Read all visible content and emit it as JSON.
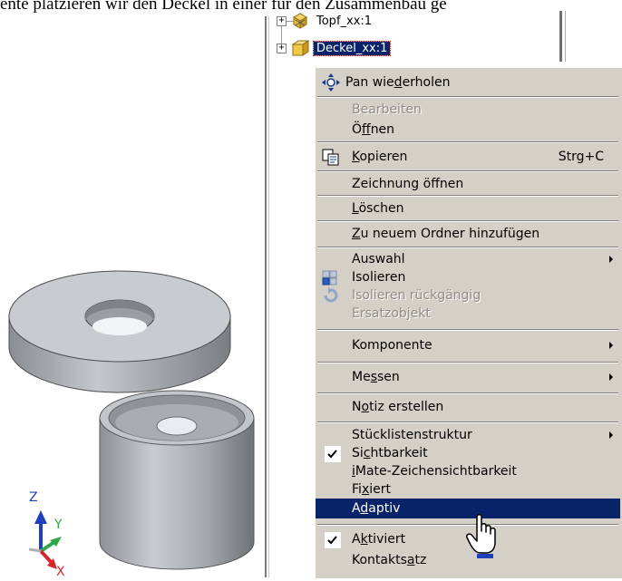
{
  "caption": "ente platzieren wir den Deckel in einer für den Zusammenbau ge",
  "tree": {
    "items": [
      {
        "label": "Topf_xx:1",
        "icon": "assembly-icon",
        "expander": "+"
      },
      {
        "label": "Deckel_xx:1",
        "icon": "part-icon",
        "expander": "+",
        "selected": true
      }
    ]
  },
  "menu": {
    "pan": {
      "pre": "Pan wie",
      "ul": "d",
      "post": "erholen"
    },
    "edit": {
      "label": "Bearbeiten",
      "disabled": true
    },
    "open": {
      "pre": "Ö",
      "ul": "f",
      "post": "fnen"
    },
    "copy": {
      "ul": "K",
      "post": "opieren",
      "shortcut": "Strg+C"
    },
    "open_drawing": {
      "pre": "Zeichnun",
      "ul": "g",
      "post": " öffnen"
    },
    "delete": {
      "ul": "L",
      "post": "öschen"
    },
    "add_folder": {
      "ul": "Z",
      "post": "u neuem Ordner hinzufügen"
    },
    "selection": {
      "label": "Auswahl"
    },
    "isolate": {
      "label": "Isolieren"
    },
    "undo_isolate": {
      "label": "Isolieren rückgängig",
      "disabled": true
    },
    "substitute": {
      "label": "Ersatzobjekt",
      "disabled": true
    },
    "component": {
      "label": "Komponente"
    },
    "measure": {
      "pre": "Me",
      "ul": "s",
      "post": "sen"
    },
    "note": {
      "pre": "N",
      "ul": "o",
      "post": "tiz erstellen"
    },
    "bom": {
      "label": "Stücklistenstruktur"
    },
    "visibility": {
      "pre": "Si",
      "ul": "c",
      "post": "htbarkeit",
      "checked": true
    },
    "imate": {
      "pre": "",
      "ul": "i",
      "post": "Mate-Zeichensichtbarkeit"
    },
    "fixed": {
      "pre": "Fi",
      "ul": "x",
      "post": "iert"
    },
    "adaptive": {
      "pre": "A",
      "ul": "d",
      "post": "aptiv",
      "highlighted": true
    },
    "activated": {
      "pre": "A",
      "ul": "k",
      "post": "tiviert",
      "checked": true
    },
    "contact_set": {
      "pre": "Kontakts",
      "ul": "a",
      "post": "tz"
    }
  },
  "axes": {
    "z": "Z",
    "y": "Y",
    "x": "X"
  },
  "colors": {
    "menu_bg": "#d4d0c8",
    "highlight": "#0a246a",
    "disabled_text": "#8f8d87"
  }
}
